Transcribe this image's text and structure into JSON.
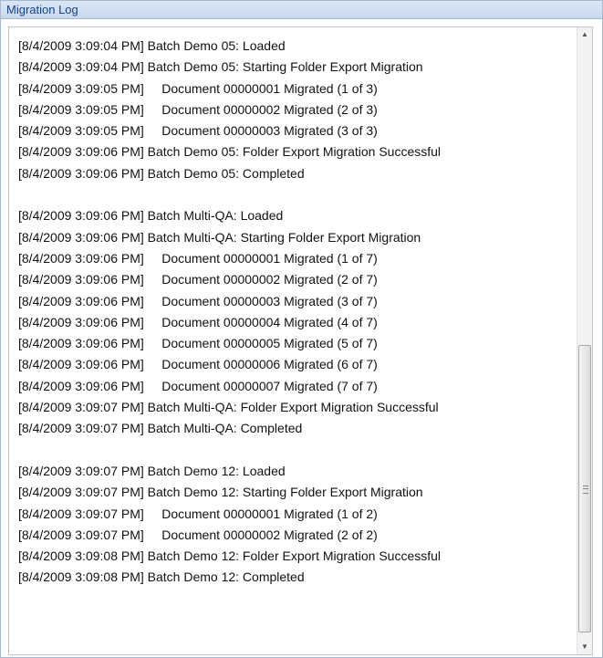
{
  "panel": {
    "title": "Migration Log",
    "lines": [
      "[8/4/2009 3:09:04 PM] Batch Demo 05: Loaded",
      "[8/4/2009 3:09:04 PM] Batch Demo 05: Starting Folder Export Migration",
      "[8/4/2009 3:09:05 PM]     Document 00000001 Migrated (1 of 3)",
      "[8/4/2009 3:09:05 PM]     Document 00000002 Migrated (2 of 3)",
      "[8/4/2009 3:09:05 PM]     Document 00000003 Migrated (3 of 3)",
      "[8/4/2009 3:09:06 PM] Batch Demo 05: Folder Export Migration Successful",
      "[8/4/2009 3:09:06 PM] Batch Demo 05: Completed",
      "",
      "[8/4/2009 3:09:06 PM] Batch Multi-QA: Loaded",
      "[8/4/2009 3:09:06 PM] Batch Multi-QA: Starting Folder Export Migration",
      "[8/4/2009 3:09:06 PM]     Document 00000001 Migrated (1 of 7)",
      "[8/4/2009 3:09:06 PM]     Document 00000002 Migrated (2 of 7)",
      "[8/4/2009 3:09:06 PM]     Document 00000003 Migrated (3 of 7)",
      "[8/4/2009 3:09:06 PM]     Document 00000004 Migrated (4 of 7)",
      "[8/4/2009 3:09:06 PM]     Document 00000005 Migrated (5 of 7)",
      "[8/4/2009 3:09:06 PM]     Document 00000006 Migrated (6 of 7)",
      "[8/4/2009 3:09:06 PM]     Document 00000007 Migrated (7 of 7)",
      "[8/4/2009 3:09:07 PM] Batch Multi-QA: Folder Export Migration Successful",
      "[8/4/2009 3:09:07 PM] Batch Multi-QA: Completed",
      "",
      "[8/4/2009 3:09:07 PM] Batch Demo 12: Loaded",
      "[8/4/2009 3:09:07 PM] Batch Demo 12: Starting Folder Export Migration",
      "[8/4/2009 3:09:07 PM]     Document 00000001 Migrated (1 of 2)",
      "[8/4/2009 3:09:07 PM]     Document 00000002 Migrated (2 of 2)",
      "[8/4/2009 3:09:08 PM] Batch Demo 12: Folder Export Migration Successful",
      "[8/4/2009 3:09:08 PM] Batch Demo 12: Completed"
    ]
  },
  "scrollbar": {
    "up_icon": "scroll-up-arrow-icon",
    "down_icon": "scroll-down-arrow-icon",
    "up_glyph": "▲",
    "down_glyph": "▼"
  }
}
